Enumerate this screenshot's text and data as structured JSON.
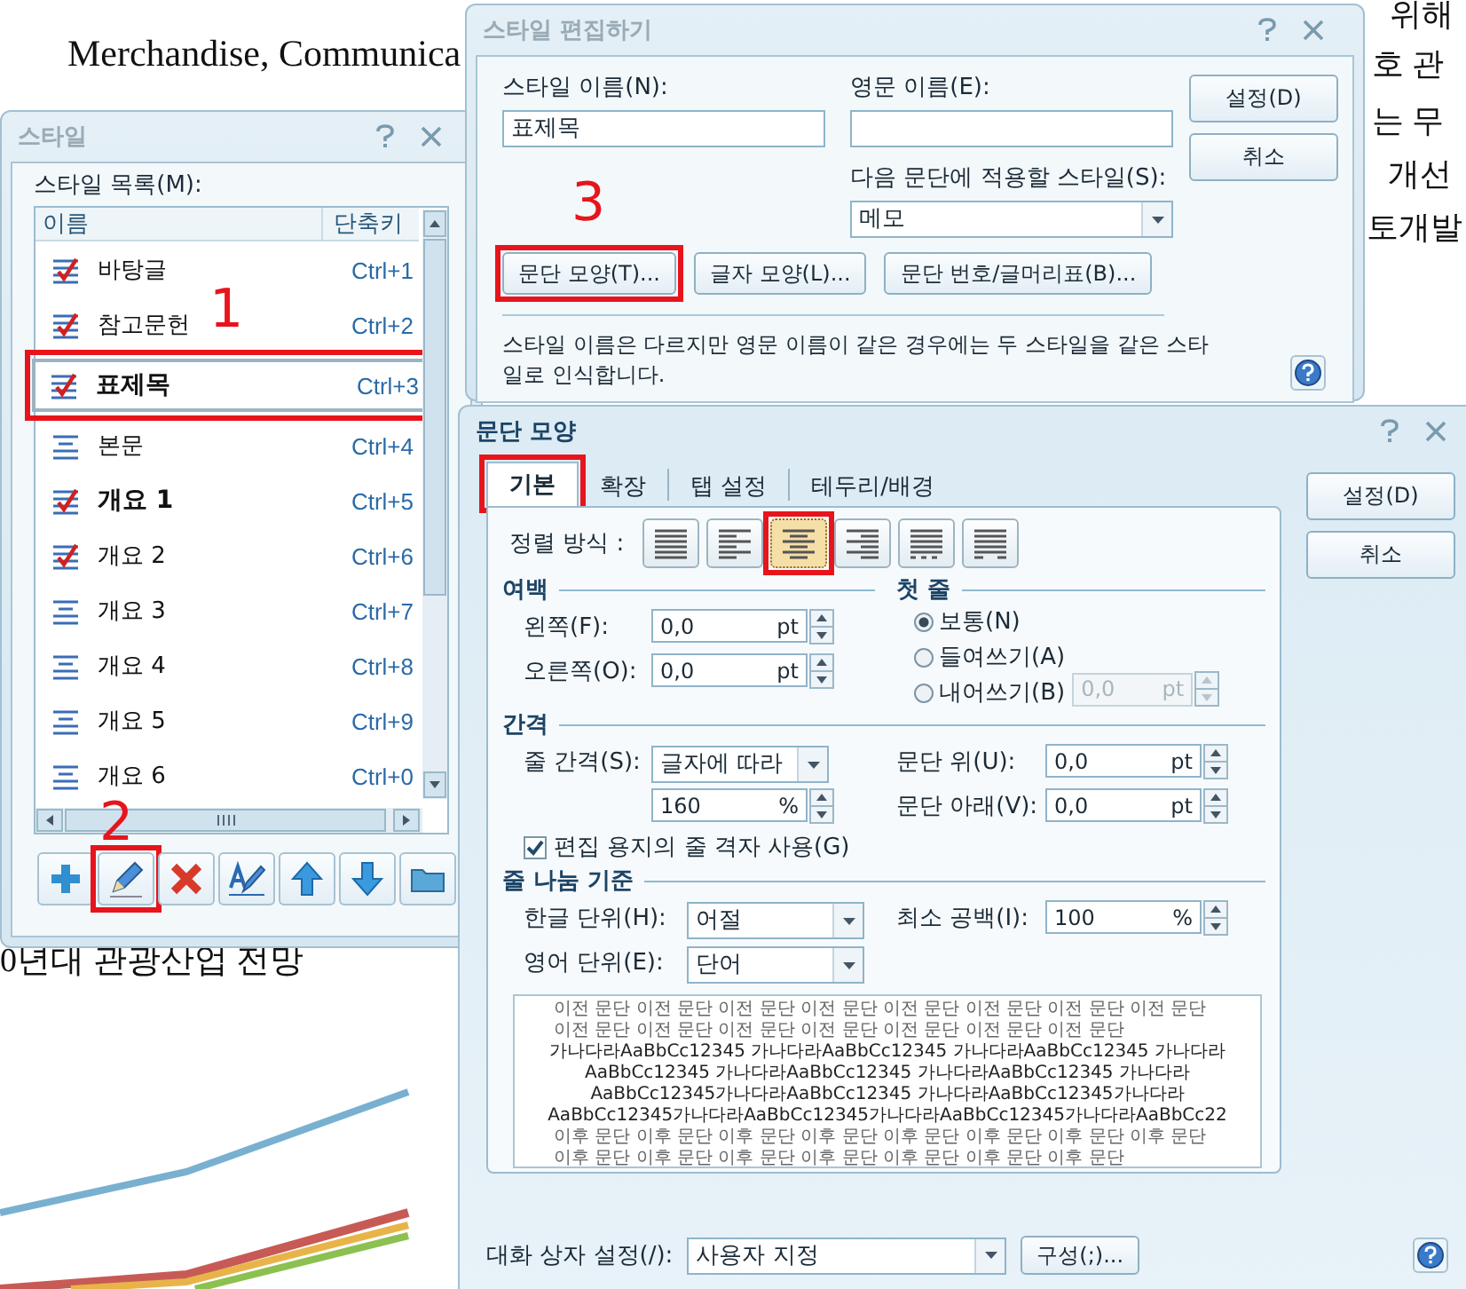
{
  "document": {
    "fragments": [
      "Merchandise, Communica",
      "위해",
      "호 관",
      "는 무",
      "개선",
      "토개발",
      "0년대 관광산업 전망"
    ]
  },
  "annotations": [
    {
      "text": "1"
    },
    {
      "text": "2"
    },
    {
      "text": "3"
    }
  ],
  "style_dialog": {
    "title": "스타일",
    "list_label": "스타일 목록(M):",
    "columns": [
      "이름",
      "단축키"
    ],
    "items": [
      {
        "name": "바탕글",
        "shortcut": "Ctrl+1",
        "kind": "check",
        "bold": false,
        "selected": false,
        "highlighted": false
      },
      {
        "name": "참고문헌",
        "shortcut": "Ctrl+2",
        "kind": "check",
        "bold": false,
        "selected": false,
        "highlighted": false
      },
      {
        "name": "표제목",
        "shortcut": "Ctrl+3",
        "kind": "check",
        "bold": true,
        "selected": true,
        "highlighted": true
      },
      {
        "name": "본문",
        "shortcut": "Ctrl+4",
        "kind": "lines",
        "bold": false,
        "selected": false,
        "highlighted": false
      },
      {
        "name": "개요 1",
        "shortcut": "Ctrl+5",
        "kind": "check",
        "bold": true,
        "selected": false,
        "highlighted": false
      },
      {
        "name": "개요 2",
        "shortcut": "Ctrl+6",
        "kind": "check",
        "bold": false,
        "selected": false,
        "highlighted": false
      },
      {
        "name": "개요 3",
        "shortcut": "Ctrl+7",
        "kind": "lines",
        "bold": false,
        "selected": false,
        "highlighted": false
      },
      {
        "name": "개요 4",
        "shortcut": "Ctrl+8",
        "kind": "lines",
        "bold": false,
        "selected": false,
        "highlighted": false
      },
      {
        "name": "개요 5",
        "shortcut": "Ctrl+9",
        "kind": "lines",
        "bold": false,
        "selected": false,
        "highlighted": false
      },
      {
        "name": "개요 6",
        "shortcut": "Ctrl+0",
        "kind": "lines",
        "bold": false,
        "selected": false,
        "highlighted": false
      }
    ],
    "tools": [
      {
        "kind": "add",
        "highlighted": false
      },
      {
        "kind": "edit",
        "highlighted": true
      },
      {
        "kind": "delete",
        "highlighted": false
      },
      {
        "kind": "format",
        "highlighted": false
      },
      {
        "kind": "up",
        "highlighted": false
      },
      {
        "kind": "down",
        "highlighted": false
      },
      {
        "kind": "folder",
        "highlighted": false
      }
    ]
  },
  "edit_dialog": {
    "title": "스타일 편집하기",
    "name_label": "스타일 이름(N):",
    "name_value": "표제목",
    "english_label": "영문 이름(E):",
    "next_label": "다음 문단에 적용할 스타일(S):",
    "next_value": "메모",
    "format_buttons": [
      {
        "label": "문단 모양(T)...",
        "highlighted": true
      },
      {
        "label": "글자 모양(L)...",
        "highlighted": false
      },
      {
        "label": "문단 번호/글머리표(B)...",
        "highlighted": false
      }
    ],
    "buttons": [
      "설정(D)",
      "취소"
    ],
    "note": "스타일 이름은 다르지만 영문 이름이 같은 경우에는 두 스타일을 같은 스타일로 인식합니다."
  },
  "paragraph_dialog": {
    "title": "문단 모양",
    "tabs": [
      {
        "label": "기본",
        "selected": true,
        "highlighted": true
      },
      {
        "label": "확장",
        "selected": false,
        "highlighted": false
      },
      {
        "label": "탭 설정",
        "selected": false,
        "highlighted": false
      },
      {
        "label": "테두리/배경",
        "selected": false,
        "highlighted": false
      }
    ],
    "alignment": {
      "label": "정렬 방식 :",
      "options": [
        {
          "kind": "justify",
          "selected": false,
          "highlighted": false
        },
        {
          "kind": "left",
          "selected": false,
          "highlighted": false
        },
        {
          "kind": "center",
          "selected": true,
          "highlighted": true
        },
        {
          "kind": "right",
          "selected": false,
          "highlighted": false
        },
        {
          "kind": "distribute",
          "selected": false,
          "highlighted": false
        },
        {
          "kind": "divide",
          "selected": false,
          "highlighted": false
        }
      ]
    },
    "margins": {
      "title": "여백",
      "fields": [
        {
          "label": "왼쪽(F):",
          "value": "0,0",
          "unit": "pt"
        },
        {
          "label": "오른쪽(O):",
          "value": "0,0",
          "unit": "pt"
        }
      ]
    },
    "first_line": {
      "title": "첫 줄",
      "options": [
        {
          "label": "보통(N)",
          "selected": true
        },
        {
          "label": "들여쓰기(A)",
          "selected": false
        },
        {
          "label": "내어쓰기(B)",
          "selected": false
        }
      ],
      "amount": {
        "value": "0,0",
        "unit": "pt",
        "disabled": true
      }
    },
    "spacing": {
      "title": "간격",
      "line_label": "줄 간격(S):",
      "line_mode": "글자에 따라",
      "line_value": "160",
      "line_unit": "%",
      "fields": [
        {
          "label": "문단 위(U):",
          "value": "0,0",
          "unit": "pt"
        },
        {
          "label": "문단 아래(V):",
          "value": "0,0",
          "unit": "pt"
        }
      ],
      "grid": {
        "label": "편집 용지의 줄 격자 사용(G)",
        "checked": true
      }
    },
    "line_break": {
      "title": "줄 나눔 기준",
      "korean_label": "한글 단위(H):",
      "korean_value": "어절",
      "english_label": "영어 단위(E):",
      "english_value": "단어",
      "min_space_label": "최소 공백(I):",
      "min_space_value": "100",
      "min_space_unit": "%"
    },
    "preview": {
      "before": "이전 문단 이전 문단 이전 문단 이전 문단 이전 문단 이전 문단 이전 문단 이전 문단 이전 문단 이전 문단 이전 문단 이전 문단 이전 문단 이전 문단 이전 문단",
      "sample": "가나다라AaBbCc12345 가나다라AaBbCc12345 가나다라AaBbCc12345 가나다라AaBbCc12345 가나다라AaBbCc12345 가나다라AaBbCc12345 가나다라AaBbCc12345가나다라AaBbCc12345 가나다라AaBbCc12345가나다라AaBbCc12345가나다라AaBbCc12345가나다라AaBbCc12345가나다라AaBbCc22",
      "after": "이후 문단 이후 문단 이후 문단 이후 문단 이후 문단 이후 문단 이후 문단 이후 문단 이후 문단 이후 문단 이후 문단 이후 문단 이후 문단 이후 문단 이후 문단"
    },
    "dialog_setting": {
      "label": "대화 상자 설정(/):",
      "value": "사용자 지정"
    },
    "configure": "구성(;)...",
    "buttons": [
      "설정(D)",
      "취소"
    ]
  }
}
